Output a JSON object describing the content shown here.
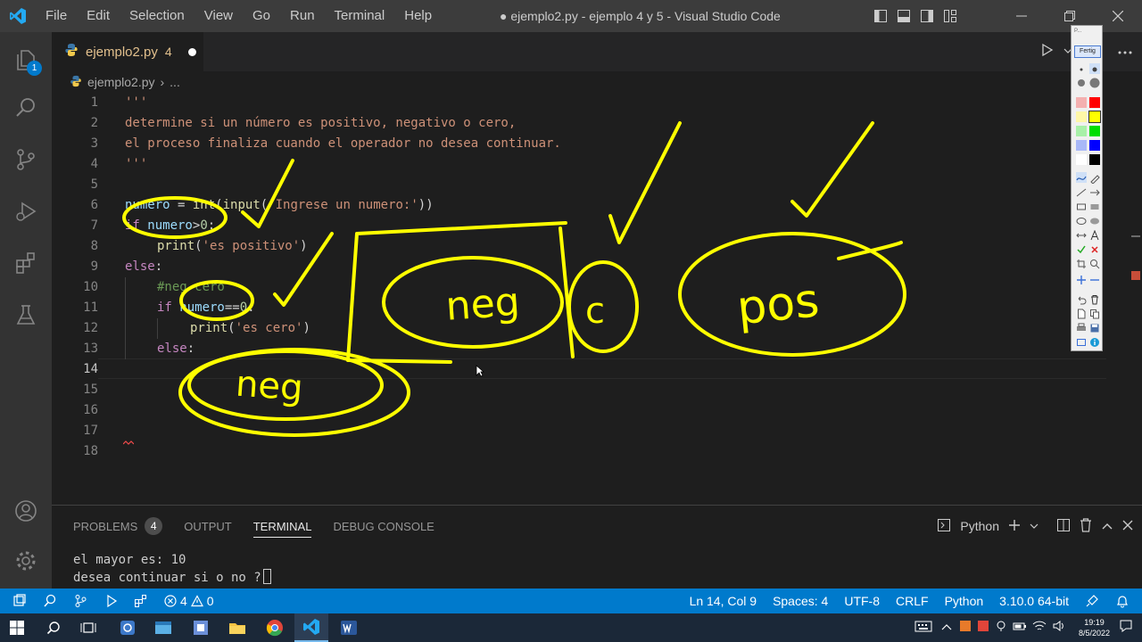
{
  "titlebar": {
    "menu": [
      "File",
      "Edit",
      "Selection",
      "View",
      "Go",
      "Run",
      "Terminal",
      "Help"
    ],
    "window_title": "● ejemplo2.py - ejemplo 4 y 5 - Visual Studio Code"
  },
  "activitybar": {
    "explorer_badge": "1"
  },
  "tab": {
    "filename": "ejemplo2.py",
    "problem_count": "4"
  },
  "breadcrumb": {
    "file": "ejemplo2.py",
    "separator": "›",
    "more": "..."
  },
  "editor": {
    "line_numbers": [
      "1",
      "2",
      "3",
      "4",
      "5",
      "6",
      "7",
      "8",
      "9",
      "10",
      "11",
      "12",
      "13",
      "14",
      "15",
      "16",
      "17",
      "18"
    ],
    "current_line": "14",
    "lines": {
      "l1": "'''",
      "l2": "determine si un número es positivo, negativo o cero,",
      "l3": "el proceso finaliza cuando el operador no desea continuar.",
      "l4": "'''",
      "l6_var": "numero",
      "l6_eq": " = ",
      "l6_int": "int",
      "l6_p1": "(",
      "l6_input": "input",
      "l6_p2": "(",
      "l6_str": "'Ingrese un numero:'",
      "l6_p3": "))",
      "l7_kw": "if",
      "l7_var": " numero",
      "l7_op": ">",
      "l7_num": "0",
      "l7_colon": ":",
      "l8_fn": "print",
      "l8_p1": "(",
      "l8_str": "'es positivo'",
      "l8_p2": ")",
      "l9_kw": "else",
      "l9_colon": ":",
      "l10_com": "#neg cero",
      "l11_kw": "if",
      "l11_var": " numero",
      "l11_op": "==",
      "l11_num": "0",
      "l11_colon": ":",
      "l12_fn": "print",
      "l12_p1": "(",
      "l12_str": "'es cero'",
      "l12_p2": ")",
      "l13_kw": "else",
      "l13_colon": ":"
    }
  },
  "annotations": {
    "neg_top": "neg",
    "cero": "c",
    "pos": "pos",
    "neg_bottom": "neg"
  },
  "pen_toolbar": {
    "done_label": "Fertig",
    "top_label": "P..."
  },
  "panel": {
    "tabs": [
      "PROBLEMS",
      "OUTPUT",
      "TERMINAL",
      "DEBUG CONSOLE"
    ],
    "problems_count": "4",
    "active_tab": "TERMINAL",
    "shell": "Python",
    "terminal_lines": [
      "el mayor es: 10",
      "desea continuar si o no ?"
    ]
  },
  "statusbar": {
    "errors": "4",
    "warnings": "0",
    "position": "Ln 14, Col 9",
    "spaces": "Spaces: 4",
    "encoding": "UTF-8",
    "eol": "CRLF",
    "language": "Python",
    "interpreter": "3.10.0 64-bit"
  },
  "taskbar": {
    "time": "19:19",
    "date": "8/5/2022"
  },
  "colors": {
    "accent": "#007acc",
    "ink": "#ffff00",
    "modified_tab": "#e2c08d"
  }
}
